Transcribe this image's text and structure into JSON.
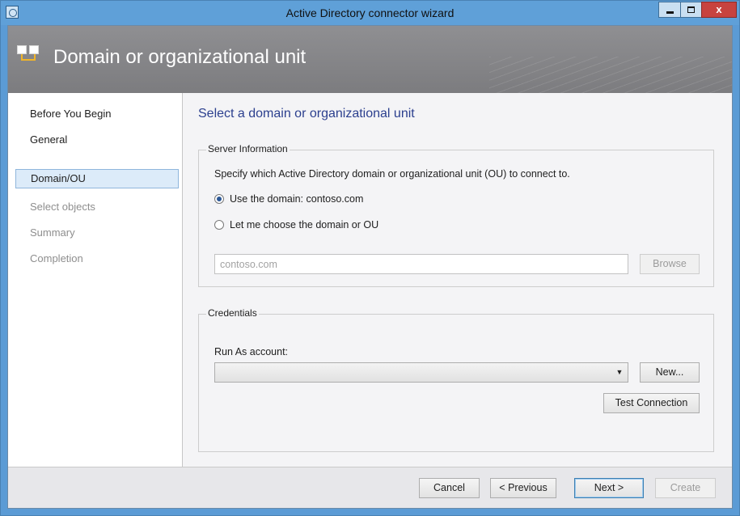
{
  "window": {
    "title": "Active Directory connector wizard",
    "close_glyph": "x"
  },
  "header": {
    "title": "Domain or organizational unit",
    "icon": "connector-icon"
  },
  "sidebar": {
    "items": [
      {
        "label": "Before You Begin",
        "state": "done"
      },
      {
        "label": "General",
        "state": "done"
      },
      {
        "label": "Domain/OU",
        "state": "active"
      },
      {
        "label": "Select objects",
        "state": "disabled"
      },
      {
        "label": "Summary",
        "state": "disabled"
      },
      {
        "label": "Completion",
        "state": "disabled"
      }
    ]
  },
  "main": {
    "heading": "Select a domain or organizational unit",
    "server": {
      "legend": "Server Information",
      "description": "Specify which Active Directory domain or organizational unit (OU) to connect to.",
      "option_domain": "Use the domain: contoso.com",
      "option_choose": "Let me choose the domain or OU",
      "selected_option": "domain",
      "domain_value": "contoso.com",
      "browse_label": "Browse"
    },
    "credentials": {
      "legend": "Credentials",
      "run_as_label": "Run As account:",
      "run_as_value": "",
      "new_label": "New...",
      "test_label": "Test Connection"
    }
  },
  "footer": {
    "cancel": "Cancel",
    "previous": "< Previous",
    "next": "Next >",
    "create": "Create"
  },
  "colors": {
    "title_bar": "#5fa0d8",
    "header_band": "#8a8a8d",
    "heading_text": "#2b3f8e",
    "nav_selected": "#dcebf9"
  }
}
